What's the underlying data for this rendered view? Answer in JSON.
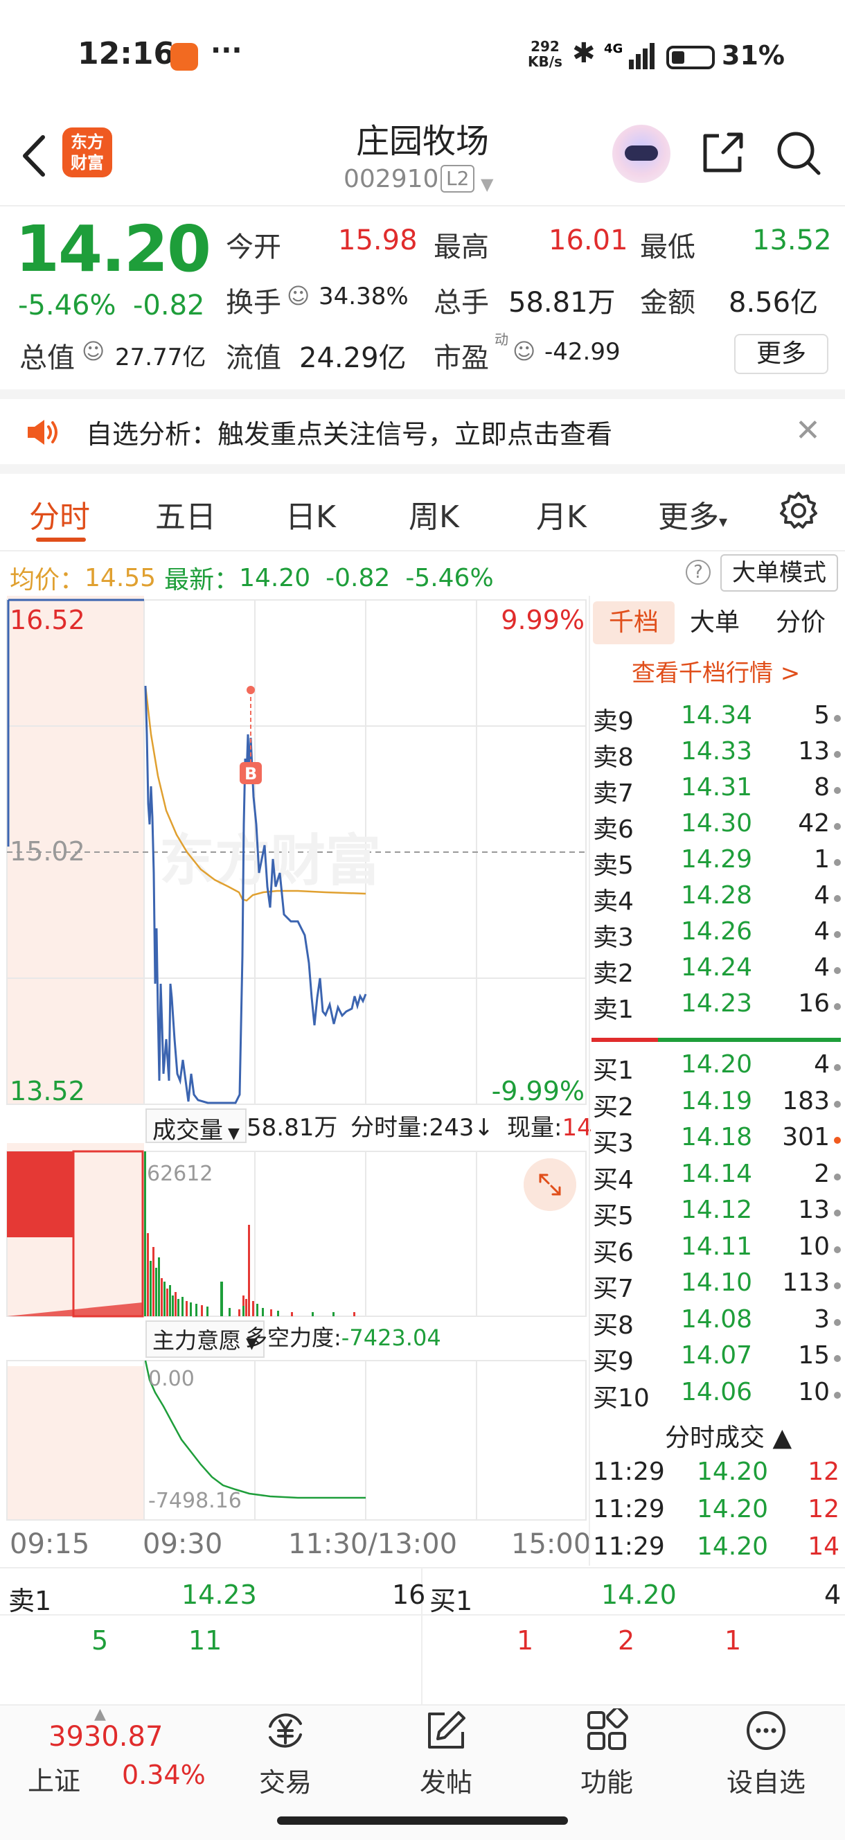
{
  "status_bar": {
    "time": "12:16",
    "net_speed_value": "292",
    "net_speed_unit": "KB/s",
    "network": "4G",
    "battery": "31%"
  },
  "header": {
    "logo_text_1": "东方",
    "logo_text_2": "财富",
    "stock_name": "庄园牧场",
    "stock_code": "002910",
    "level": "L2"
  },
  "quote": {
    "price": "14.20",
    "change_pct": "-5.46%",
    "change": "-0.82",
    "open_label": "今开",
    "open": "15.98",
    "high_label": "最高",
    "high": "16.01",
    "low_label": "最低",
    "low": "13.52",
    "turnover_label": "换手",
    "turnover": "34.38%",
    "volume_label": "总手",
    "volume": "58.81万",
    "amount_label": "金额",
    "amount": "8.56亿",
    "mktcap_label": "总值",
    "mktcap": "27.77亿",
    "float_label": "流值",
    "float": "24.29亿",
    "pe_label": "市盈",
    "pe_super": "动",
    "pe": "-42.99",
    "more": "更多"
  },
  "banner": {
    "text": "自选分析：触发重点关注信号，立即点击查看"
  },
  "tabs": [
    "分时",
    "五日",
    "日K",
    "周K",
    "月K",
    "更多"
  ],
  "info_row": {
    "avg_label": "均价：",
    "avg": "14.55",
    "last_label": "最新：",
    "last": "14.20",
    "chg": "-0.82",
    "pct": "-5.46%",
    "help": "?",
    "mode": "大单模式"
  },
  "chart": {
    "y_top": "16.52",
    "y_mid": "15.02",
    "y_bot": "13.52",
    "pct_top": "9.99%",
    "pct_bot": "-9.99%",
    "watermark": "东方财富",
    "marker": "B",
    "vol_label": "成交量",
    "vol_total": "58.81万",
    "vol_fs": "分时量:243↓",
    "vol_now_label": "现量:",
    "vol_now": "14",
    "vol_max": "62612",
    "main_label": "主力意愿",
    "main_force_label": "多空力度:",
    "main_force": "-7423.04",
    "main_top": "0.00",
    "main_bot": "-7498.16",
    "x_labels": [
      "09:15",
      "09:30",
      "11:30/13:00",
      "15:00"
    ]
  },
  "orderbook": {
    "tabs": [
      "千档",
      "大单",
      "分价"
    ],
    "link": "查看千档行情 >",
    "asks": [
      {
        "label": "卖9",
        "price": "14.34",
        "vol": "5"
      },
      {
        "label": "卖8",
        "price": "14.33",
        "vol": "13"
      },
      {
        "label": "卖7",
        "price": "14.31",
        "vol": "8"
      },
      {
        "label": "卖6",
        "price": "14.30",
        "vol": "42"
      },
      {
        "label": "卖5",
        "price": "14.29",
        "vol": "1"
      },
      {
        "label": "卖4",
        "price": "14.28",
        "vol": "4"
      },
      {
        "label": "卖3",
        "price": "14.26",
        "vol": "4"
      },
      {
        "label": "卖2",
        "price": "14.24",
        "vol": "4"
      },
      {
        "label": "卖1",
        "price": "14.23",
        "vol": "16"
      }
    ],
    "bids": [
      {
        "label": "买1",
        "price": "14.20",
        "vol": "4"
      },
      {
        "label": "买2",
        "price": "14.19",
        "vol": "183"
      },
      {
        "label": "买3",
        "price": "14.18",
        "vol": "301"
      },
      {
        "label": "买4",
        "price": "14.14",
        "vol": "2"
      },
      {
        "label": "买5",
        "price": "14.12",
        "vol": "13"
      },
      {
        "label": "买6",
        "price": "14.11",
        "vol": "10"
      },
      {
        "label": "买7",
        "price": "14.10",
        "vol": "113"
      },
      {
        "label": "买8",
        "price": "14.08",
        "vol": "3"
      },
      {
        "label": "买9",
        "price": "14.07",
        "vol": "15"
      },
      {
        "label": "买10",
        "price": "14.06",
        "vol": "10"
      }
    ],
    "ticks_title": "分时成交 ▲",
    "ticks": [
      {
        "time": "11:29",
        "price": "14.20",
        "vol": "12"
      },
      {
        "time": "11:29",
        "price": "14.20",
        "vol": "12"
      },
      {
        "time": "11:29",
        "price": "14.20",
        "vol": "14"
      }
    ]
  },
  "lower": {
    "ask_label": "卖1",
    "ask_price": "14.23",
    "ask_vol": "16",
    "bid_label": "买1",
    "bid_price": "14.20",
    "bid_vol": "4",
    "ask_queue": [
      "5",
      "11"
    ],
    "bid_queue": [
      "1",
      "2",
      "1"
    ]
  },
  "nav": {
    "index_value": "3930.87",
    "index_name": "上证",
    "index_pct": "0.34%",
    "items": [
      "交易",
      "发帖",
      "功能",
      "设自选"
    ]
  },
  "colors": {
    "up": "#e02c2c",
    "down": "#1e9e3a",
    "accent": "#e04e1a",
    "price_line": "#3b64b0",
    "avg_line": "#e0a030"
  },
  "icons": {
    "back": "chevron-left-icon",
    "share": "share-icon",
    "search": "search-icon",
    "speaker": "speaker-icon",
    "close": "close-icon",
    "settings": "gear-icon",
    "expand": "expand-icon"
  }
}
